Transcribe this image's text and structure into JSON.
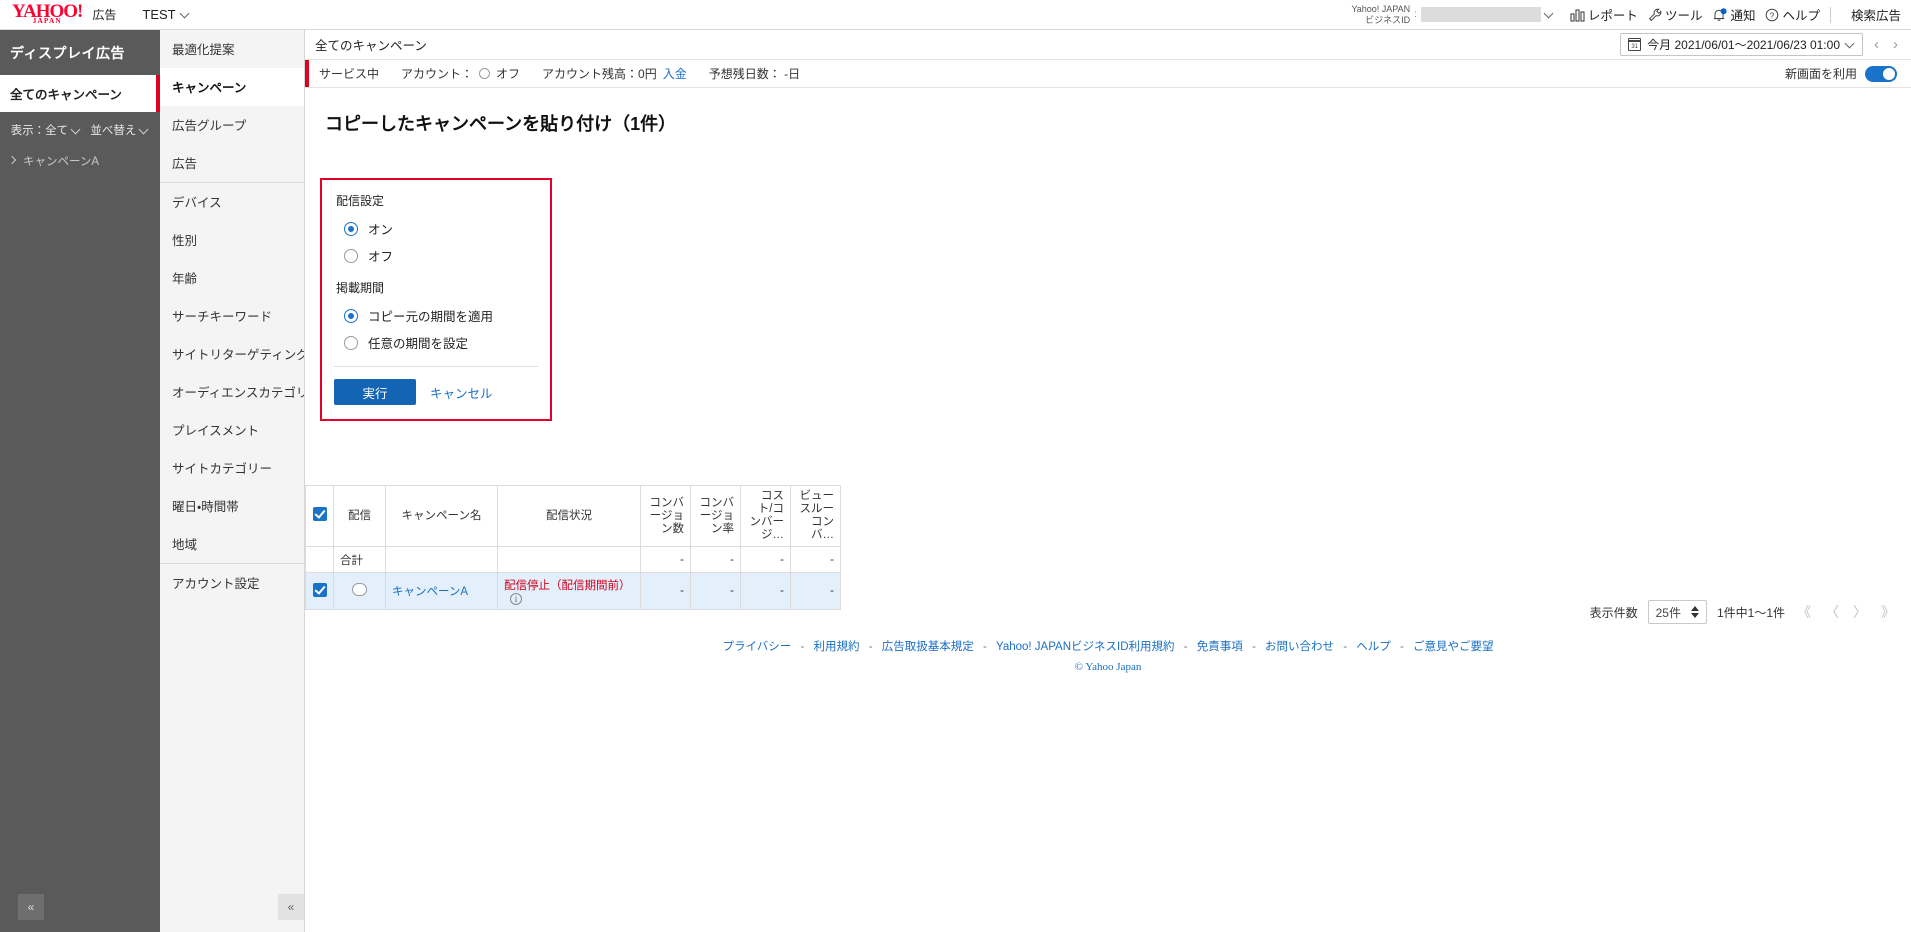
{
  "colors": {
    "brand_red": "#ff0033",
    "accent_blue": "#1a73c8",
    "link_blue": "#1a6fc4",
    "alert_red": "#e4002b",
    "status_red": "#d0021b",
    "sidebar_dark": "#5a5a5a"
  },
  "global_header": {
    "logo_main": "YAHOO!",
    "logo_sub": "JAPAN",
    "logo_keyword": "広告",
    "account_name": "TEST",
    "bizid_label_line1": "Yahoo! JAPAN",
    "bizid_label_line2": "ビジネスID",
    "bizid_colon": ":",
    "bizid_value": "",
    "items": [
      {
        "label": "レポート",
        "icon": "report-chart-icon"
      },
      {
        "label": "ツール",
        "icon": "wrench-icon"
      },
      {
        "label": "通知",
        "icon": "bell-icon"
      },
      {
        "label": "ヘルプ",
        "icon": "question-circle-icon"
      }
    ],
    "product_switch": "検索広告"
  },
  "left_panel": {
    "title": "ディスプレイ広告",
    "current": "全てのキャンペーン",
    "filters": [
      {
        "label": "表示：全て",
        "icon": "chevron-down-icon"
      },
      {
        "label": "並べ替え",
        "icon": "chevron-down-icon"
      }
    ],
    "tree": [
      {
        "label": "キャンペーンA",
        "icon": "chevron-right-icon"
      }
    ],
    "collapse_label": "«"
  },
  "nav": {
    "items": [
      {
        "label": "最適化提案",
        "selected": false,
        "divider": false
      },
      {
        "label": "キャンペーン",
        "selected": true,
        "divider": false
      },
      {
        "label": "広告グループ",
        "selected": false,
        "divider": false
      },
      {
        "label": "広告",
        "selected": false,
        "divider": false
      },
      {
        "label": "デバイス",
        "selected": false,
        "divider": true
      },
      {
        "label": "性別",
        "selected": false,
        "divider": false
      },
      {
        "label": "年齢",
        "selected": false,
        "divider": false
      },
      {
        "label": "サーチキーワード",
        "selected": false,
        "divider": false
      },
      {
        "label": "サイトリターゲティング",
        "selected": false,
        "divider": false
      },
      {
        "label": "オーディエンスカテゴリー",
        "selected": false,
        "divider": false
      },
      {
        "label": "プレイスメント",
        "selected": false,
        "divider": false
      },
      {
        "label": "サイトカテゴリー",
        "selected": false,
        "divider": false
      },
      {
        "label": "曜日・時間帯",
        "selected": false,
        "divider": false
      },
      {
        "label": "地域",
        "selected": false,
        "divider": false
      },
      {
        "label": "アカウント設定",
        "selected": false,
        "divider": true
      }
    ],
    "collapse_label": "«"
  },
  "breadcrumb": {
    "label": "全てのキャンペーン",
    "date_range": "今月 2021/06/01〜2021/06/23 01:00",
    "calendar_icon": "calendar-icon",
    "prev_label": "‹",
    "next_label": "›"
  },
  "status_bar": {
    "service_status": "サービス中",
    "account_label": "アカウント：",
    "account_state": "オフ",
    "balance": "アカウント残高：0円",
    "deposit_link": "入金",
    "remaining_days": "予想残日数： -日",
    "new_ui_label": "新画面を利用",
    "new_ui_on": true
  },
  "page": {
    "title": "コピーしたキャンペーンを貼り付け（1件）"
  },
  "dialog": {
    "section1_label": "配信設定",
    "section1_options": [
      {
        "label": "オン",
        "selected": true
      },
      {
        "label": "オフ",
        "selected": false
      }
    ],
    "section2_label": "掲載期間",
    "section2_options": [
      {
        "label": "コピー元の期間を適用",
        "selected": true
      },
      {
        "label": "任意の期間を設定",
        "selected": false
      }
    ],
    "submit_label": "実行",
    "cancel_label": "キャンセル"
  },
  "table": {
    "headers": [
      {
        "label": "",
        "icon": "checkbox-checked-icon",
        "type": "check"
      },
      {
        "label": "配信",
        "type": "text"
      },
      {
        "label": "キャンペーン名",
        "type": "text"
      },
      {
        "label": "配信状況",
        "type": "text"
      },
      {
        "label": "コンバージョン数",
        "type": "num"
      },
      {
        "label": "コンバージョン率",
        "type": "num"
      },
      {
        "label": "コスト/コンバージ…",
        "type": "num"
      },
      {
        "label": "ビュースルーコンバ…",
        "type": "num"
      }
    ],
    "total_row": {
      "label": "合計",
      "values": [
        "-",
        "-",
        "-",
        "-"
      ]
    },
    "rows": [
      {
        "checked": true,
        "delivery_toggle": "off-pill",
        "name": "キャンペーンA",
        "status": "配信停止（配信期間前）",
        "status_info_icon": "info-icon",
        "values": [
          "-",
          "-",
          "-",
          "-"
        ]
      }
    ]
  },
  "pager": {
    "rows_label": "表示件数",
    "rows_value": "25件",
    "range_label": "1件中1〜1件",
    "first_label": "《",
    "prev_label": "〈",
    "next_label": "〉",
    "last_label": "》"
  },
  "footer": {
    "links": [
      "プライバシー",
      "利用規約",
      "広告取扱基本規定",
      "Yahoo! JAPANビジネスID利用規約",
      "免責事項",
      "お問い合わせ",
      "ヘルプ",
      "ご意見やご要望"
    ],
    "separator": "-",
    "copyright": "© Yahoo Japan"
  }
}
